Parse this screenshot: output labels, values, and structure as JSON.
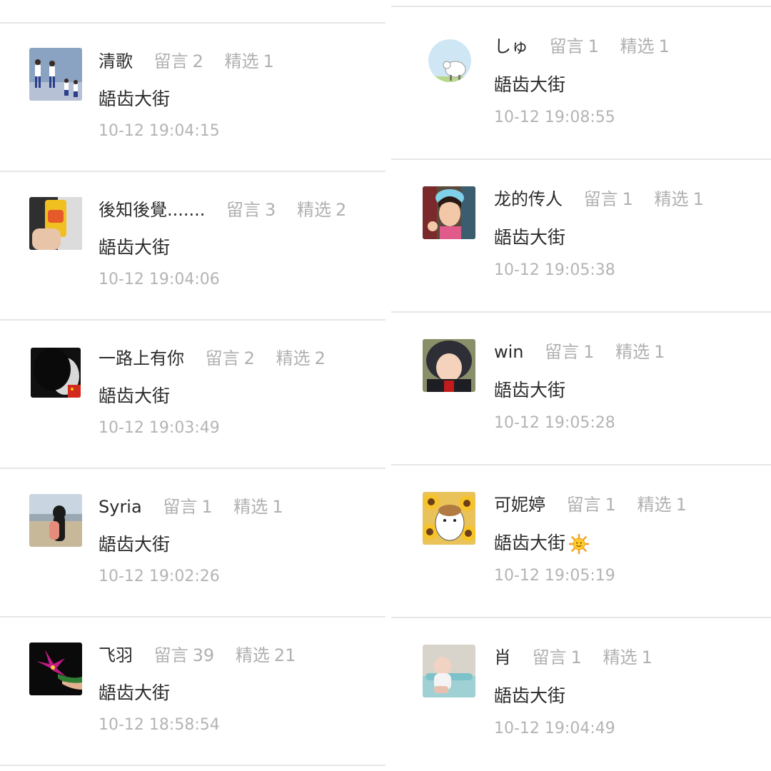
{
  "left": [
    {
      "name": "清歌",
      "comments_label": "留言",
      "comments": "2",
      "featured_label": "精选",
      "featured": "1",
      "message": "龉齿大街",
      "time": "10-12 19:04:15",
      "avatar": "avatar-dancers"
    },
    {
      "name": "後知後覺.......",
      "comments_label": "留言",
      "comments": "3",
      "featured_label": "精选",
      "featured": "2",
      "message": "龉齿大街",
      "time": "10-12 19:04:06",
      "avatar": "avatar-drink-cup"
    },
    {
      "name": "一路上有你",
      "comments_label": "留言",
      "comments": "2",
      "featured_label": "精选",
      "featured": "2",
      "message": "龉齿大街",
      "time": "10-12 19:03:49",
      "avatar": "avatar-bw-face"
    },
    {
      "name": "Syria",
      "comments_label": "留言",
      "comments": "1",
      "featured_label": "精选",
      "featured": "1",
      "message": "龉齿大街",
      "time": "10-12 19:02:26",
      "avatar": "avatar-beach"
    },
    {
      "name": "飞羽",
      "comments_label": "留言",
      "comments": "39",
      "featured_label": "精选",
      "featured": "21",
      "message": "龉齿大街",
      "time": "10-12 18:58:54",
      "avatar": "avatar-flower"
    }
  ],
  "right": [
    {
      "name": "しゅ",
      "comments_label": "留言",
      "comments": "1",
      "featured_label": "精选",
      "featured": "1",
      "message": "龉齿大街",
      "time": "10-12 19:08:55",
      "avatar": "avatar-sheep"
    },
    {
      "name": "龙的传人",
      "comments_label": "留言",
      "comments": "1",
      "featured_label": "精选",
      "featured": "1",
      "message": "龉齿大街",
      "time": "10-12 19:05:38",
      "avatar": "avatar-girl"
    },
    {
      "name": "win",
      "comments_label": "留言",
      "comments": "1",
      "featured_label": "精选",
      "featured": "1",
      "message": "龉齿大街",
      "time": "10-12 19:05:28",
      "avatar": "avatar-child-hood"
    },
    {
      "name": "可妮婷",
      "comments_label": "留言",
      "comments": "1",
      "featured_label": "精选",
      "featured": "1",
      "message": "龉齿大街",
      "time": "10-12 19:05:19",
      "avatar": "avatar-sunflower",
      "emoji": "sun-emoji"
    },
    {
      "name": "肖",
      "comments_label": "留言",
      "comments": "1",
      "featured_label": "精选",
      "featured": "1",
      "message": "龉齿大街",
      "time": "10-12 19:04:49",
      "avatar": "avatar-baby"
    }
  ]
}
